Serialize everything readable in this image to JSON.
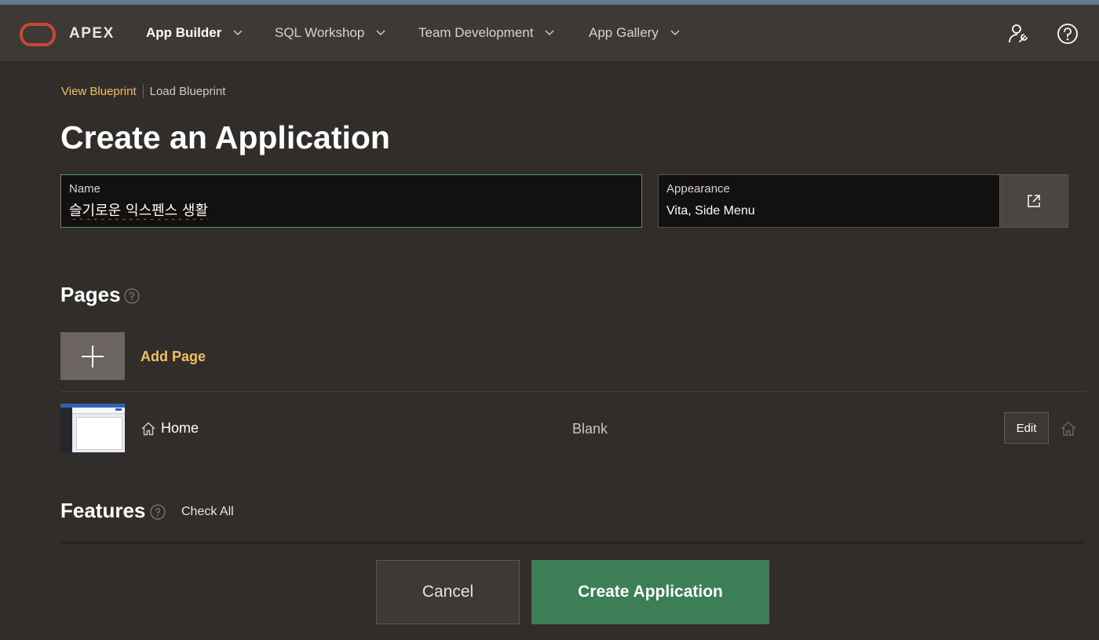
{
  "header": {
    "brand": "APEX",
    "nav": [
      {
        "label": "App Builder",
        "active": true
      },
      {
        "label": "SQL Workshop"
      },
      {
        "label": "Team Development"
      },
      {
        "label": "App Gallery"
      }
    ],
    "icons": [
      "oracle-logo-icon",
      "user-wrench-icon",
      "help-circle-icon"
    ]
  },
  "breadcrumbs": {
    "view": "View Blueprint",
    "load": "Load Blueprint"
  },
  "title": "Create an Application",
  "name_field": {
    "label": "Name",
    "value": "슬기로운 익스펜스 생활"
  },
  "appearance_field": {
    "label": "Appearance",
    "value": "Vita, Side Menu",
    "button_icon": "external-link-icon"
  },
  "pages_section": {
    "title": "Pages",
    "add_label": "Add Page",
    "rows": [
      {
        "name": "Home",
        "type": "Blank",
        "edit_label": "Edit",
        "icon": "home-icon"
      }
    ]
  },
  "features_section": {
    "title": "Features",
    "check_all": "Check All"
  },
  "footer": {
    "cancel": "Cancel",
    "create": "Create Application"
  },
  "colors": {
    "background": "#312d2a",
    "header": "#3d3a36",
    "accent_gold": "#f0c060",
    "create_green": "#3c7f56",
    "oracle_red": "#c74634"
  }
}
